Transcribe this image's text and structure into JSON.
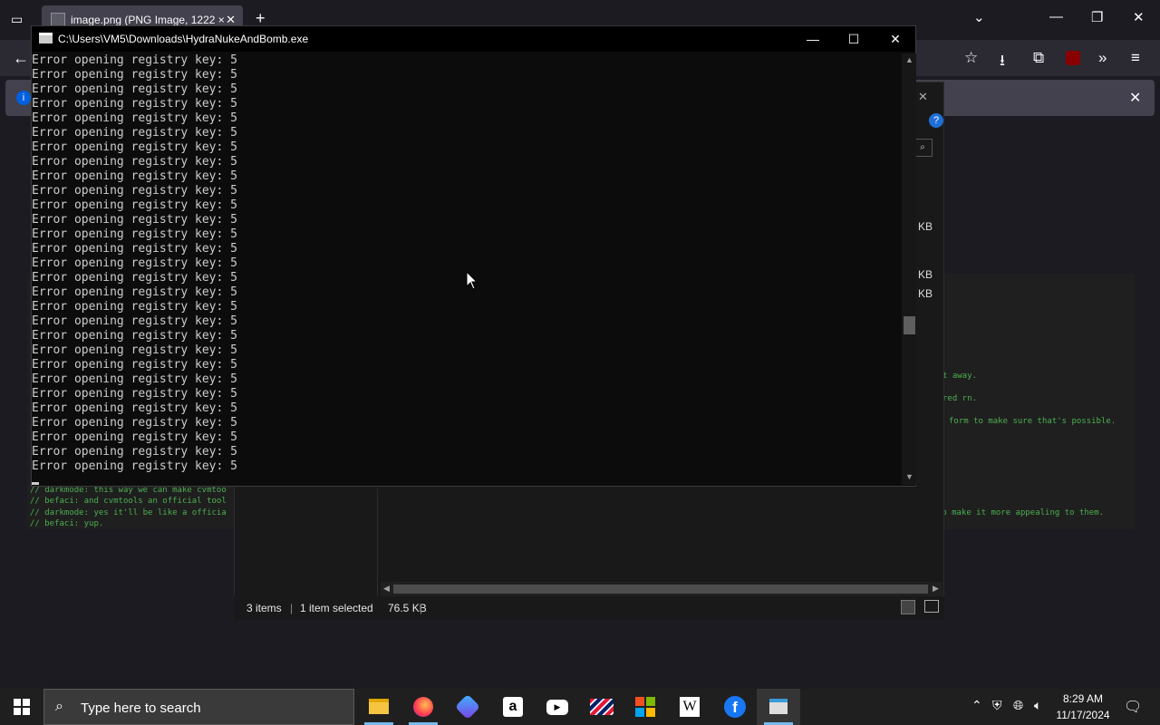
{
  "browser": {
    "tab_title": "image.png (PNG Image, 1222 ×",
    "tab_close": "✕",
    "new_tab": "+"
  },
  "explorer": {
    "status": {
      "items": "3 items",
      "selected": "1 item selected",
      "size": "76.5 KB"
    },
    "sizes": [
      "KB",
      "KB",
      "KB"
    ]
  },
  "code_panel": {
    "lines_right": [
      "t away.",
      "red rn.",
      "form to make sure that's possible.",
      "s to make it more appealing to them."
    ],
    "lines_left": [
      "// darkmode: this way we can make cvmtoo",
      "// befaci: and cvmtools an official tool",
      "// darkmode: yes it'll be like a officia",
      "// befaci: yup."
    ]
  },
  "console": {
    "title": "C:\\Users\\VM5\\Downloads\\HydraNukeAndBomb.exe",
    "lines": [
      "Error opening registry key: 5",
      "Error opening registry key: 5",
      "Error opening registry key: 5",
      "Error opening registry key: 5",
      "Error opening registry key: 5",
      "Error opening registry key: 5",
      "Error opening registry key: 5",
      "Error opening registry key: 5",
      "Error opening registry key: 5",
      "Error opening registry key: 5",
      "Error opening registry key: 5",
      "Error opening registry key: 5",
      "Error opening registry key: 5",
      "Error opening registry key: 5",
      "Error opening registry key: 5",
      "Error opening registry key: 5",
      "Error opening registry key: 5",
      "Error opening registry key: 5",
      "Error opening registry key: 5",
      "Error opening registry key: 5",
      "Error opening registry key: 5",
      "Error opening registry key: 5",
      "Error opening registry key: 5",
      "Error opening registry key: 5",
      "Error opening registry key: 5",
      "Error opening registry key: 5",
      "Error opening registry key: 5",
      "Error opening registry key: 5",
      "Error opening registry key: 5"
    ]
  },
  "taskbar": {
    "search_placeholder": "Type here to search",
    "time": "8:29 AM",
    "date": "11/17/2024",
    "apps": [
      "file-explorer",
      "firefox",
      "copilot",
      "amazon",
      "youtube",
      "bank-of-america",
      "microsoft-store",
      "wikipedia",
      "facebook",
      "console"
    ]
  },
  "colors": {
    "console_bg": "#0c0c0c",
    "console_text": "#cccccc",
    "code_green": "#4caf50",
    "taskbar_bg": "#1f1f1f",
    "accent": "#76b9ed"
  }
}
